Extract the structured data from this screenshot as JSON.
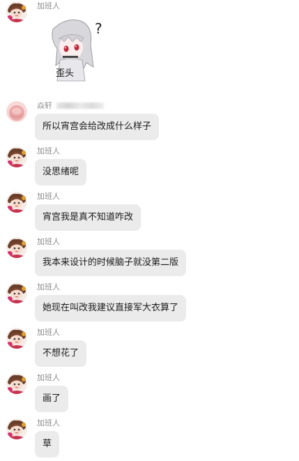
{
  "messages": [
    {
      "sender": "加班人",
      "type": "sticker",
      "sticker_caption": "歪头",
      "avatar": "anime-girl-avatar"
    },
    {
      "sender": "焱轩",
      "type": "text",
      "text": "所以宵宫会给改成什么样子",
      "avatar": "pink-blob-avatar"
    },
    {
      "sender": "加班人",
      "type": "text",
      "text": "没思绪呢",
      "avatar": "anime-girl-avatar"
    },
    {
      "sender": "加班人",
      "type": "text",
      "text": "宵宫我是真不知道咋改",
      "avatar": "anime-girl-avatar"
    },
    {
      "sender": "加班人",
      "type": "text",
      "text": "我本来设计的时候脑子就没第二版",
      "avatar": "anime-girl-avatar"
    },
    {
      "sender": "加班人",
      "type": "text",
      "text": "她现在叫改我建议直接军大衣算了",
      "avatar": "anime-girl-avatar"
    },
    {
      "sender": "加班人",
      "type": "text",
      "text": "不想花了",
      "avatar": "anime-girl-avatar"
    },
    {
      "sender": "加班人",
      "type": "text",
      "text": "画了",
      "avatar": "anime-girl-avatar"
    },
    {
      "sender": "加班人",
      "type": "text",
      "text": "草",
      "avatar": "anime-girl-avatar"
    }
  ],
  "colors": {
    "bubble": "#ebebeb",
    "name": "#8a8a8a",
    "text": "#1a1a1a"
  }
}
